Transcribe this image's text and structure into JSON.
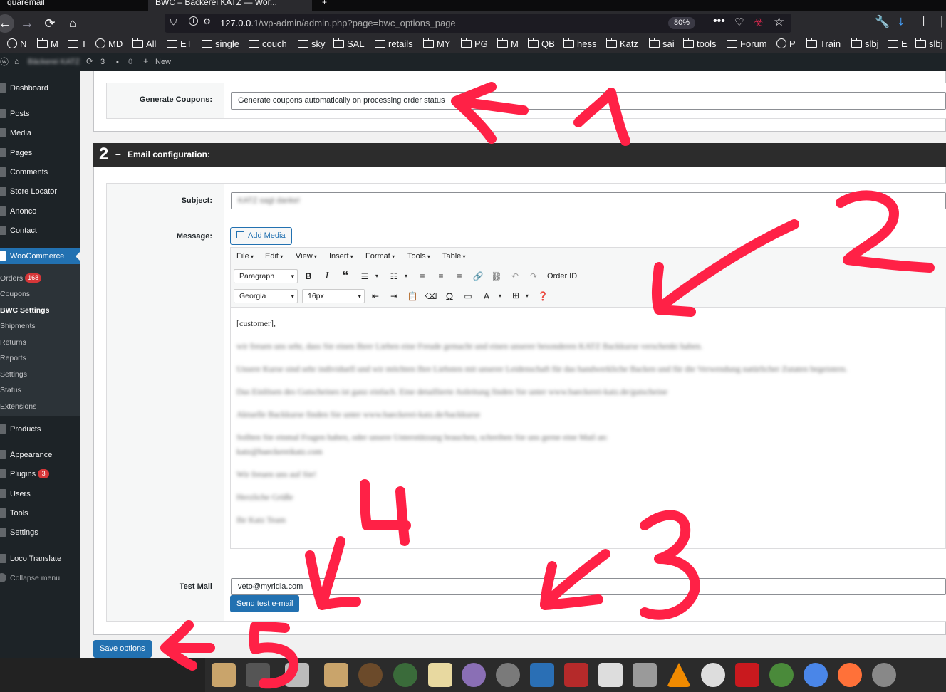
{
  "browser": {
    "tabs": [
      "quaremail",
      "BWC – Bäckerei KATZ — Wor...",
      "+"
    ],
    "url_host": "127.0.0.1",
    "url_path": "/wp-admin/admin.php?page=bwc_options_page",
    "zoom": "80%",
    "bookmarks": [
      "N",
      "M",
      "T",
      "MD",
      "All",
      "ET",
      "single",
      "couch",
      "sky",
      "SAL",
      "retails",
      "MY",
      "PG",
      "M",
      "QB",
      "hess",
      "Katz",
      "sai",
      "tools",
      "Forum",
      "P",
      "Train",
      "slbj",
      "E",
      "slbj"
    ]
  },
  "adminbar": {
    "site_name": "Bäckerei KATZ",
    "updates": "3",
    "comments": "0",
    "new_label": "New"
  },
  "sidebar": {
    "items": [
      "Dashboard",
      "Posts",
      "Media",
      "Pages",
      "Comments",
      "Store Locator",
      "Anonco",
      "Contact",
      "WooCommerce",
      "Products",
      "Appearance",
      "Plugins",
      "Users",
      "Tools",
      "Settings",
      "Loco Translate",
      "Collapse menu"
    ],
    "woo_sub": [
      "Orders",
      "Coupons",
      "BWC Settings",
      "Shipments",
      "Returns",
      "Reports",
      "Settings",
      "Status",
      "Extensions"
    ],
    "orders_badge": "168",
    "plugins_badge": "3"
  },
  "settings": {
    "generate_label": "Generate Coupons:",
    "generate_value": "Generate coupons automatically on processing order status",
    "section_num": "2",
    "section_dash": "–",
    "section_title": "Email configuration:",
    "subject_label": "Subject:",
    "subject_value": "KATZ sagt danke!",
    "message_label": "Message:",
    "add_media": "Add Media",
    "menus": [
      "File",
      "Edit",
      "View",
      "Insert",
      "Format",
      "Tools",
      "Table"
    ],
    "format_select": "Paragraph",
    "font_select": "Georgia",
    "size_select": "16px",
    "order_id": "Order ID",
    "body": [
      "[customer],",
      "wir freuen uns sehr, dass Sie einen Ihrer Lieben eine Freude gemacht und einen unserer besonderen KATZ Backkurse verschenkt haben.",
      "Unsere Kurse sind sehr individuell und wir möchten Ihre Liebsten mit unserer Leidenschaft für das handwerkliche Backen und für die Verwendung natürlicher Zutaten begeistern.",
      "Das Einlösen des Gutscheines ist ganz einfach. Eine detaillierte Anleitung finden Sie unter www.baeckerei-katz.de/gutscheine",
      "Aktuelle Backkurse finden Sie unter www.baeckerei-katz.de/backkurse",
      "Sollten Sie einmal Fragen haben, oder unsere Unterstützung brauchen, schreiben Sie uns gerne eine Mail an:",
      "katz@baeckereikatz.com",
      "Wir freuen uns auf Sie!",
      "Herzliche Grüße",
      "Ihr Katz Team"
    ],
    "test_label": "Test Mail",
    "test_value": "veto@myridia.com",
    "send_button": "Send test e-mail",
    "save_button": "Save options"
  },
  "annotations": {
    "marks": [
      "1",
      "2",
      "3",
      "4",
      "5"
    ],
    "color": "#ff2146"
  }
}
